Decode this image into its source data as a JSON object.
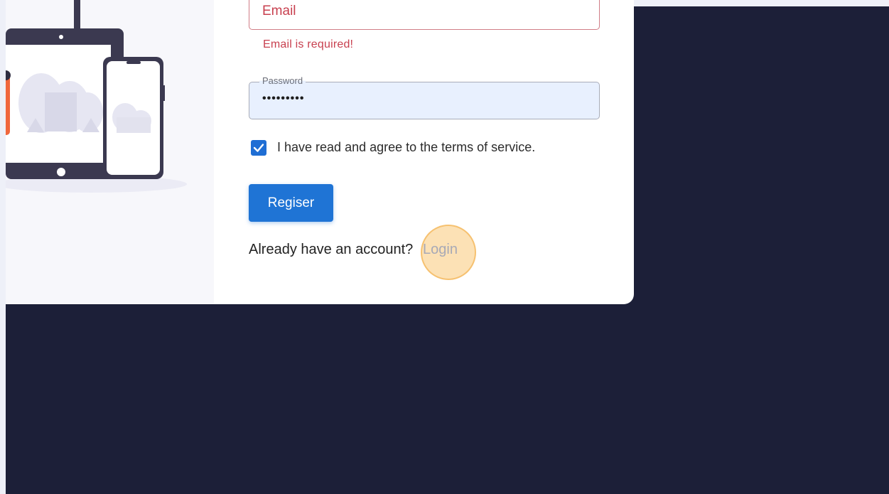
{
  "form": {
    "email_placeholder": "Email",
    "email_error": "Email is required!",
    "password_label": "Password",
    "password_value": "•••••••••",
    "terms_label": "I have read and agree to the terms of service.",
    "terms_checked": true,
    "register_button_label": "Regiser",
    "account_prompt": "Already have an account?",
    "login_link": "Login"
  },
  "colors": {
    "accent": "#1f74d5",
    "error": "#c8404f",
    "backdrop": "#1c1f38",
    "click_highlight": "#f5b95f"
  },
  "icons": {
    "checkbox": "check-icon",
    "illustration": "devices-illustration"
  }
}
